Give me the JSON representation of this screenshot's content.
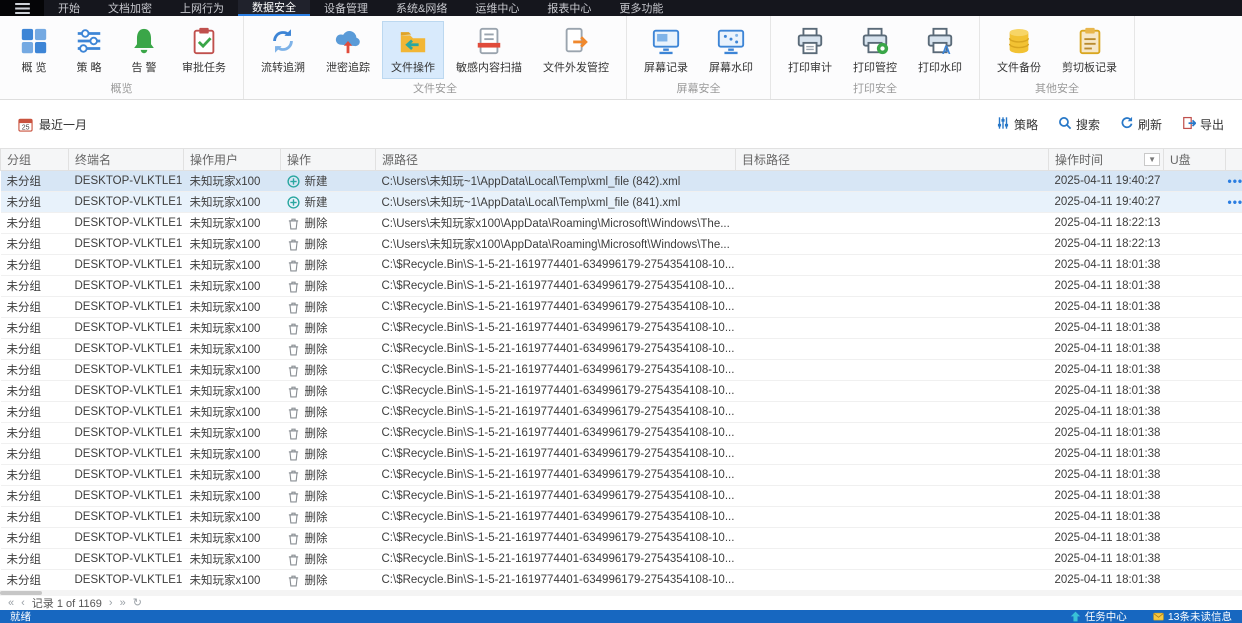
{
  "menu": {
    "items": [
      {
        "label": "开始",
        "active": false
      },
      {
        "label": "文档加密",
        "active": false
      },
      {
        "label": "上网行为",
        "active": false
      },
      {
        "label": "数据安全",
        "active": true
      },
      {
        "label": "设备管理",
        "active": false
      },
      {
        "label": "系统&网络",
        "active": false
      },
      {
        "label": "运维中心",
        "active": false
      },
      {
        "label": "报表中心",
        "active": false
      },
      {
        "label": "更多功能",
        "active": false
      }
    ]
  },
  "ribbon": {
    "groups": [
      {
        "label": "概览",
        "items": [
          {
            "label": "概 览",
            "icon": "grid-icon",
            "active": false
          },
          {
            "label": "策 略",
            "icon": "policy-icon",
            "active": false
          },
          {
            "label": "告 警",
            "icon": "alert-icon",
            "active": false
          },
          {
            "label": "审批任务",
            "icon": "approval-icon",
            "active": false
          }
        ]
      },
      {
        "label": "文件安全",
        "items": [
          {
            "label": "流转追溯",
            "icon": "trace-icon",
            "active": false
          },
          {
            "label": "泄密追踪",
            "icon": "leak-icon",
            "active": false
          },
          {
            "label": "文件操作",
            "icon": "file-op-icon",
            "active": true
          },
          {
            "label": "敏感内容扫描",
            "icon": "scan-icon",
            "active": false
          },
          {
            "label": "文件外发管控",
            "icon": "outgoing-icon",
            "active": false
          }
        ]
      },
      {
        "label": "屏幕安全",
        "items": [
          {
            "label": "屏幕记录",
            "icon": "screen-record-icon",
            "active": false
          },
          {
            "label": "屏幕水印",
            "icon": "screen-watermark-icon",
            "active": false
          }
        ]
      },
      {
        "label": "打印安全",
        "items": [
          {
            "label": "打印审计",
            "icon": "print-audit-icon",
            "active": false
          },
          {
            "label": "打印管控",
            "icon": "print-control-icon",
            "active": false
          },
          {
            "label": "打印水印",
            "icon": "print-watermark-icon",
            "active": false
          }
        ]
      },
      {
        "label": "其他安全",
        "items": [
          {
            "label": "文件备份",
            "icon": "backup-icon",
            "active": false
          },
          {
            "label": "剪切板记录",
            "icon": "clipboard-icon",
            "active": false
          }
        ]
      }
    ]
  },
  "toolbar": {
    "date_filter": "最近一月",
    "actions": [
      {
        "label": "策略",
        "icon": "policy-filter-icon"
      },
      {
        "label": "搜索",
        "icon": "search-icon"
      },
      {
        "label": "刷新",
        "icon": "refresh-icon"
      },
      {
        "label": "导出",
        "icon": "export-icon"
      }
    ]
  },
  "table": {
    "columns": [
      {
        "label": "分组",
        "filter": false
      },
      {
        "label": "终端名",
        "filter": false
      },
      {
        "label": "操作用户",
        "filter": false
      },
      {
        "label": "操作",
        "filter": false
      },
      {
        "label": "源路径",
        "filter": false
      },
      {
        "label": "目标路径",
        "filter": false
      },
      {
        "label": "操作时间",
        "filter": true
      },
      {
        "label": "U盘",
        "filter": false
      },
      {
        "label": "",
        "filter": false
      }
    ],
    "rows": [
      {
        "group": "未分组",
        "terminal": "DESKTOP-VLKTLE1",
        "user": "未知玩家x100",
        "op": "新建",
        "op_icon": "create-icon",
        "src": "C:\\Users\\未知玩~1\\AppData\\Local\\Temp\\xml_file (842).xml",
        "dst": "",
        "time": "2025-04-11 19:40:27",
        "usb": "",
        "highlight": "hl1",
        "menu": true
      },
      {
        "group": "未分组",
        "terminal": "DESKTOP-VLKTLE1",
        "user": "未知玩家x100",
        "op": "新建",
        "op_icon": "create-icon",
        "src": "C:\\Users\\未知玩~1\\AppData\\Local\\Temp\\xml_file (841).xml",
        "dst": "",
        "time": "2025-04-11 19:40:27",
        "usb": "",
        "highlight": "hl2",
        "menu": true
      },
      {
        "group": "未分组",
        "terminal": "DESKTOP-VLKTLE1",
        "user": "未知玩家x100",
        "op": "删除",
        "op_icon": "delete-icon",
        "src": "C:\\Users\\未知玩家x100\\AppData\\Roaming\\Microsoft\\Windows\\The...",
        "dst": "",
        "time": "2025-04-11 18:22:13",
        "usb": "",
        "highlight": "",
        "menu": false
      },
      {
        "group": "未分组",
        "terminal": "DESKTOP-VLKTLE1",
        "user": "未知玩家x100",
        "op": "删除",
        "op_icon": "delete-icon",
        "src": "C:\\Users\\未知玩家x100\\AppData\\Roaming\\Microsoft\\Windows\\The...",
        "dst": "",
        "time": "2025-04-11 18:22:13",
        "usb": "",
        "highlight": "",
        "menu": false
      },
      {
        "group": "未分组",
        "terminal": "DESKTOP-VLKTLE1",
        "user": "未知玩家x100",
        "op": "删除",
        "op_icon": "delete-icon",
        "src": "C:\\$Recycle.Bin\\S-1-5-21-1619774401-634996179-2754354108-10...",
        "dst": "",
        "time": "2025-04-11 18:01:38",
        "usb": "",
        "highlight": "",
        "menu": false
      },
      {
        "group": "未分组",
        "terminal": "DESKTOP-VLKTLE1",
        "user": "未知玩家x100",
        "op": "删除",
        "op_icon": "delete-icon",
        "src": "C:\\$Recycle.Bin\\S-1-5-21-1619774401-634996179-2754354108-10...",
        "dst": "",
        "time": "2025-04-11 18:01:38",
        "usb": "",
        "highlight": "",
        "menu": false
      },
      {
        "group": "未分组",
        "terminal": "DESKTOP-VLKTLE1",
        "user": "未知玩家x100",
        "op": "删除",
        "op_icon": "delete-icon",
        "src": "C:\\$Recycle.Bin\\S-1-5-21-1619774401-634996179-2754354108-10...",
        "dst": "",
        "time": "2025-04-11 18:01:38",
        "usb": "",
        "highlight": "",
        "menu": false
      },
      {
        "group": "未分组",
        "terminal": "DESKTOP-VLKTLE1",
        "user": "未知玩家x100",
        "op": "删除",
        "op_icon": "delete-icon",
        "src": "C:\\$Recycle.Bin\\S-1-5-21-1619774401-634996179-2754354108-10...",
        "dst": "",
        "time": "2025-04-11 18:01:38",
        "usb": "",
        "highlight": "",
        "menu": false
      },
      {
        "group": "未分组",
        "terminal": "DESKTOP-VLKTLE1",
        "user": "未知玩家x100",
        "op": "删除",
        "op_icon": "delete-icon",
        "src": "C:\\$Recycle.Bin\\S-1-5-21-1619774401-634996179-2754354108-10...",
        "dst": "",
        "time": "2025-04-11 18:01:38",
        "usb": "",
        "highlight": "",
        "menu": false
      },
      {
        "group": "未分组",
        "terminal": "DESKTOP-VLKTLE1",
        "user": "未知玩家x100",
        "op": "删除",
        "op_icon": "delete-icon",
        "src": "C:\\$Recycle.Bin\\S-1-5-21-1619774401-634996179-2754354108-10...",
        "dst": "",
        "time": "2025-04-11 18:01:38",
        "usb": "",
        "highlight": "",
        "menu": false
      },
      {
        "group": "未分组",
        "terminal": "DESKTOP-VLKTLE1",
        "user": "未知玩家x100",
        "op": "删除",
        "op_icon": "delete-icon",
        "src": "C:\\$Recycle.Bin\\S-1-5-21-1619774401-634996179-2754354108-10...",
        "dst": "",
        "time": "2025-04-11 18:01:38",
        "usb": "",
        "highlight": "",
        "menu": false
      },
      {
        "group": "未分组",
        "terminal": "DESKTOP-VLKTLE1",
        "user": "未知玩家x100",
        "op": "删除",
        "op_icon": "delete-icon",
        "src": "C:\\$Recycle.Bin\\S-1-5-21-1619774401-634996179-2754354108-10...",
        "dst": "",
        "time": "2025-04-11 18:01:38",
        "usb": "",
        "highlight": "",
        "menu": false
      },
      {
        "group": "未分组",
        "terminal": "DESKTOP-VLKTLE1",
        "user": "未知玩家x100",
        "op": "删除",
        "op_icon": "delete-icon",
        "src": "C:\\$Recycle.Bin\\S-1-5-21-1619774401-634996179-2754354108-10...",
        "dst": "",
        "time": "2025-04-11 18:01:38",
        "usb": "",
        "highlight": "",
        "menu": false
      },
      {
        "group": "未分组",
        "terminal": "DESKTOP-VLKTLE1",
        "user": "未知玩家x100",
        "op": "删除",
        "op_icon": "delete-icon",
        "src": "C:\\$Recycle.Bin\\S-1-5-21-1619774401-634996179-2754354108-10...",
        "dst": "",
        "time": "2025-04-11 18:01:38",
        "usb": "",
        "highlight": "",
        "menu": false
      },
      {
        "group": "未分组",
        "terminal": "DESKTOP-VLKTLE1",
        "user": "未知玩家x100",
        "op": "删除",
        "op_icon": "delete-icon",
        "src": "C:\\$Recycle.Bin\\S-1-5-21-1619774401-634996179-2754354108-10...",
        "dst": "",
        "time": "2025-04-11 18:01:38",
        "usb": "",
        "highlight": "",
        "menu": false
      },
      {
        "group": "未分组",
        "terminal": "DESKTOP-VLKTLE1",
        "user": "未知玩家x100",
        "op": "删除",
        "op_icon": "delete-icon",
        "src": "C:\\$Recycle.Bin\\S-1-5-21-1619774401-634996179-2754354108-10...",
        "dst": "",
        "time": "2025-04-11 18:01:38",
        "usb": "",
        "highlight": "",
        "menu": false
      },
      {
        "group": "未分组",
        "terminal": "DESKTOP-VLKTLE1",
        "user": "未知玩家x100",
        "op": "删除",
        "op_icon": "delete-icon",
        "src": "C:\\$Recycle.Bin\\S-1-5-21-1619774401-634996179-2754354108-10...",
        "dst": "",
        "time": "2025-04-11 18:01:38",
        "usb": "",
        "highlight": "",
        "menu": false
      },
      {
        "group": "未分组",
        "terminal": "DESKTOP-VLKTLE1",
        "user": "未知玩家x100",
        "op": "删除",
        "op_icon": "delete-icon",
        "src": "C:\\$Recycle.Bin\\S-1-5-21-1619774401-634996179-2754354108-10...",
        "dst": "",
        "time": "2025-04-11 18:01:38",
        "usb": "",
        "highlight": "",
        "menu": false
      },
      {
        "group": "未分组",
        "terminal": "DESKTOP-VLKTLE1",
        "user": "未知玩家x100",
        "op": "删除",
        "op_icon": "delete-icon",
        "src": "C:\\$Recycle.Bin\\S-1-5-21-1619774401-634996179-2754354108-10...",
        "dst": "",
        "time": "2025-04-11 18:01:38",
        "usb": "",
        "highlight": "",
        "menu": false
      },
      {
        "group": "未分组",
        "terminal": "DESKTOP-VLKTLE1",
        "user": "未知玩家x100",
        "op": "删除",
        "op_icon": "delete-icon",
        "src": "C:\\$Recycle.Bin\\S-1-5-21-1619774401-634996179-2754354108-10...",
        "dst": "",
        "time": "2025-04-11 18:01:38",
        "usb": "",
        "highlight": "",
        "menu": false
      }
    ]
  },
  "pagination": {
    "label": "记录 1 of 1169"
  },
  "statusbar": {
    "ready": "就绪",
    "task_center": "任务中心",
    "messages": "13条未读信息"
  },
  "colors": {
    "accent": "#2a7de1",
    "statusbar_bg": "#1767c0",
    "menubar_bg": "#15161d",
    "selected_row": "#d7e6f5"
  }
}
